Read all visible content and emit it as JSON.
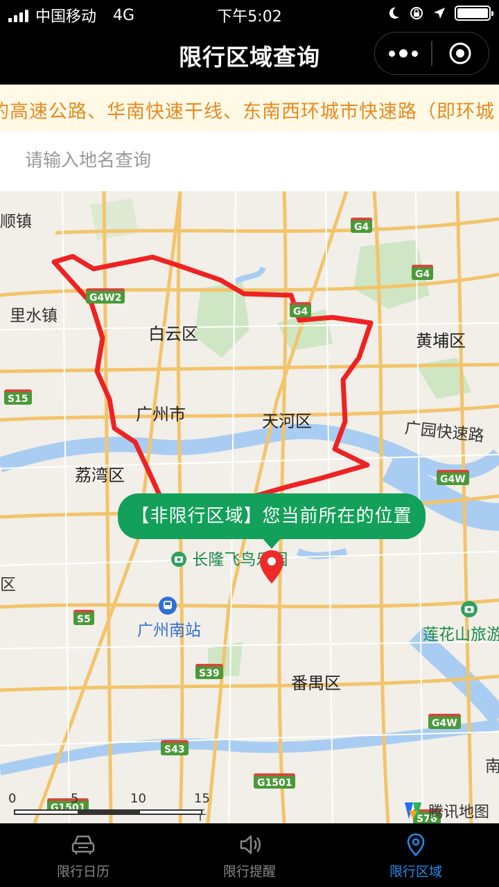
{
  "status_bar": {
    "carrier": "中国移动",
    "network": "4G",
    "time": "下午5:02"
  },
  "nav": {
    "title": "限行区域查询"
  },
  "notice": {
    "text": "的高速公路、华南快速干线、东南西环城市快速路（即环城"
  },
  "search": {
    "placeholder": "请输入地名查询"
  },
  "map": {
    "place_labels": {
      "shunzhen": "顺镇",
      "lishuizhen": "里水镇",
      "baiyunqu": "白云区",
      "huangpuqu": "黄埔区",
      "guangzhoushi": "广州市",
      "tianhequ": "天河区",
      "guangyuan": "广园快速路",
      "liwanqu": "荔湾区",
      "changlong": "长隆飞鸟乐园",
      "guangzhounan": "广州南站",
      "lianhuashan": "莲花山旅游",
      "panyuqu": "番禺区",
      "edge_qu": "区",
      "edge_nan": "南"
    },
    "road_shields": {
      "g4_a": "G4",
      "g4_b": "G4",
      "g4w2": "G4W2",
      "g4_c": "G4",
      "s15": "S15",
      "g4w_a": "G4W",
      "s5": "S5",
      "s39": "S39",
      "g4w_b": "G4W",
      "s43": "S43",
      "g1501": "G1501",
      "g1501_b": "G1501",
      "s76": "S76"
    },
    "tooltip": "【非限行区域】您当前所在的位置",
    "scale": {
      "n0": "0",
      "n5": "5",
      "n10": "10",
      "n15": "15 千米"
    },
    "provider": "腾讯地图",
    "colors": {
      "restriction_line": "#ee2222",
      "tooltip_bg": "#13a05a",
      "pin": "#ee2b2b"
    }
  },
  "tabbar": {
    "tabs": [
      {
        "label": "限行日历",
        "icon": "car-icon"
      },
      {
        "label": "限行提醒",
        "icon": "speaker-icon"
      },
      {
        "label": "限行区域",
        "icon": "location-pin-icon"
      }
    ],
    "active_color": "#1e8ff0"
  }
}
